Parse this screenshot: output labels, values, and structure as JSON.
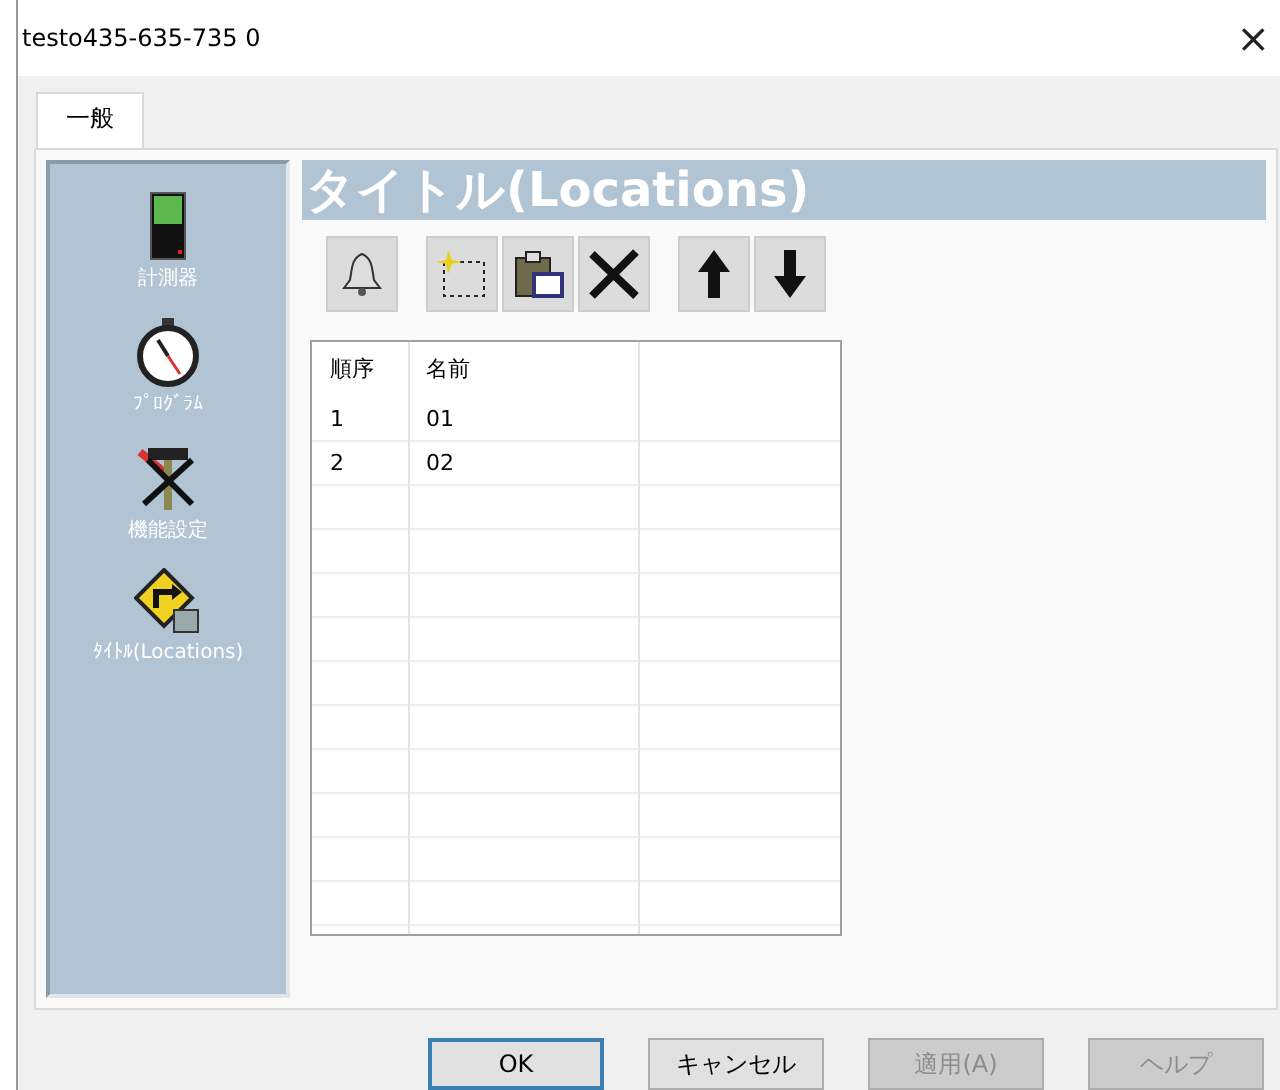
{
  "window": {
    "title": "testo435-635-735 0",
    "close": "×"
  },
  "tabs": [
    {
      "label": "一般",
      "selected": true
    }
  ],
  "sidebar": {
    "items": [
      {
        "label": "計測器",
        "kind": "meter"
      },
      {
        "label": "ﾌﾟﾛｸﾞﾗﾑ",
        "kind": "stopwatch"
      },
      {
        "label": "機能設定",
        "kind": "tools"
      },
      {
        "label": "ﾀｲﾄﾙ(Locations)",
        "kind": "sign"
      }
    ]
  },
  "header": {
    "title": "タイトル(Locations)"
  },
  "toolbar": [
    {
      "kind": "bell"
    },
    {
      "kind": "new"
    },
    {
      "kind": "paste"
    },
    {
      "kind": "delete"
    },
    {
      "kind": "up"
    },
    {
      "kind": "down"
    }
  ],
  "table": {
    "columns": [
      "順序",
      "名前"
    ],
    "rows": [
      [
        "1",
        "01"
      ],
      [
        "2",
        "02"
      ]
    ]
  },
  "buttons": [
    {
      "label": "OK",
      "disabled": false,
      "default": true
    },
    {
      "label": "キャンセル",
      "disabled": false,
      "default": false
    },
    {
      "label": "適用(A)",
      "disabled": true,
      "default": false
    },
    {
      "label": "ヘルプ",
      "disabled": true,
      "default": false
    }
  ]
}
